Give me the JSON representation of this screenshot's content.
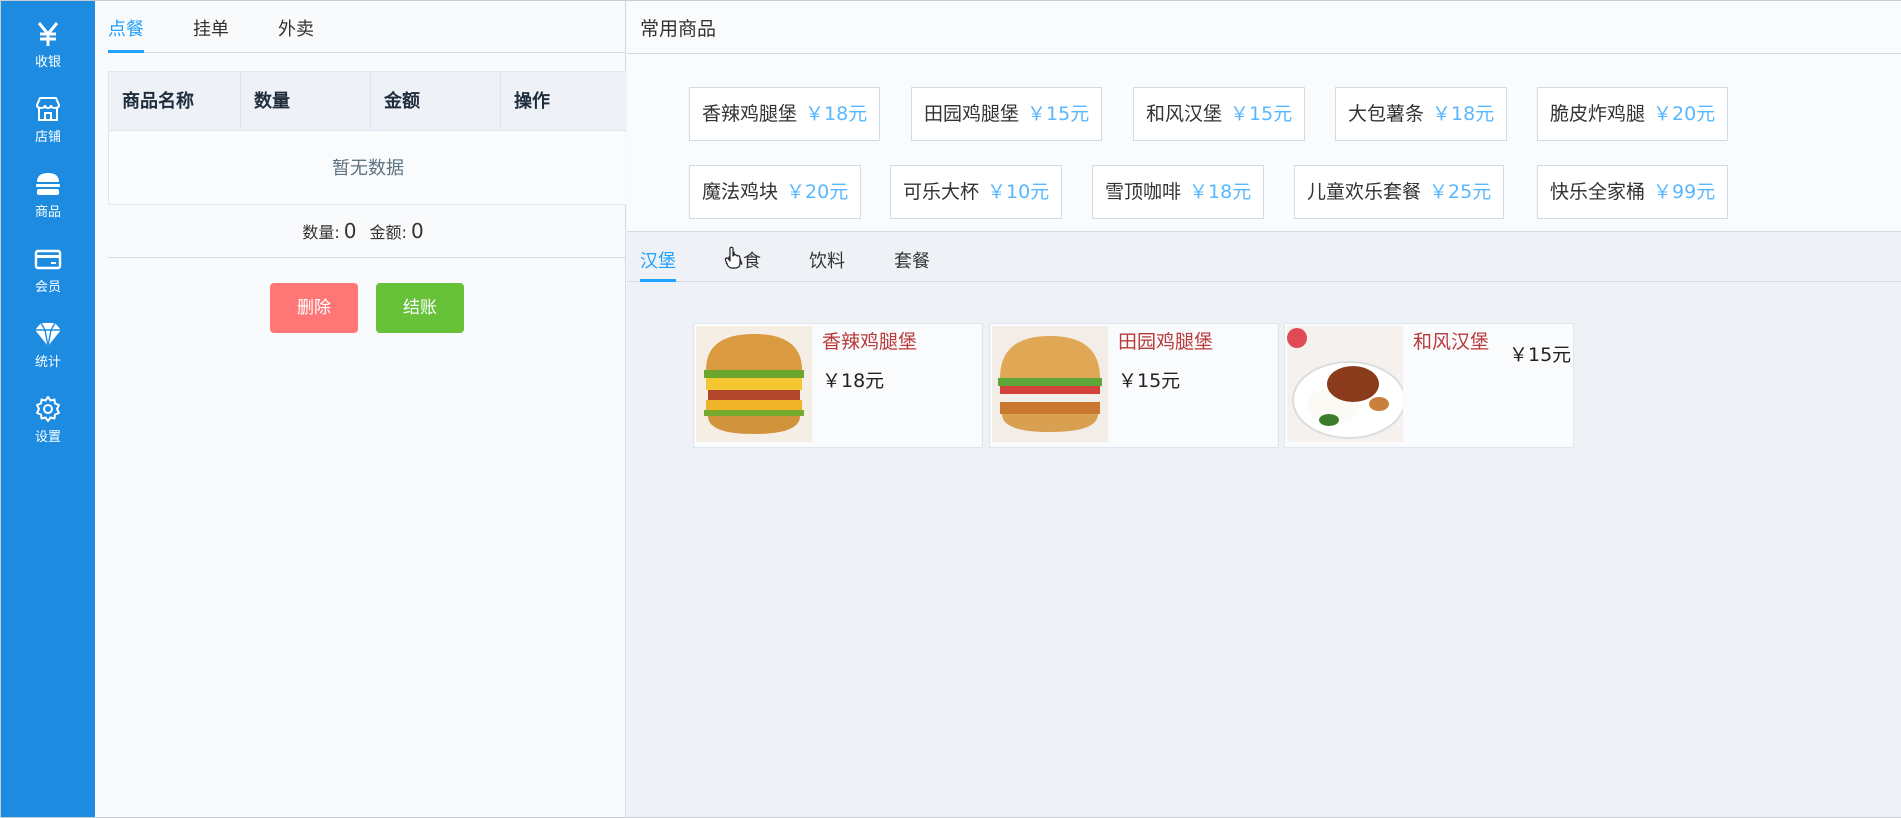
{
  "nav": [
    {
      "label": "收银",
      "icon": "yen-icon"
    },
    {
      "label": "店铺",
      "icon": "store-icon"
    },
    {
      "label": "商品",
      "icon": "burger-icon"
    },
    {
      "label": "会员",
      "icon": "card-icon"
    },
    {
      "label": "统计",
      "icon": "diamond-icon"
    },
    {
      "label": "设置",
      "icon": "gear-icon"
    }
  ],
  "order": {
    "tabs": [
      "点餐",
      "挂单",
      "外卖"
    ],
    "active_tab": "点餐",
    "columns": [
      "商品名称",
      "数量",
      "金额",
      "操作"
    ],
    "empty_text": "暂无数据",
    "count_label": "数量:",
    "count_value": "0",
    "amount_label": "金额:",
    "amount_value": "0",
    "delete_label": "删除",
    "pay_label": "结账"
  },
  "favorites": {
    "title": "常用商品",
    "items": [
      {
        "name": "香辣鸡腿堡",
        "price": "￥18元"
      },
      {
        "name": "田园鸡腿堡",
        "price": "￥15元"
      },
      {
        "name": "和风汉堡",
        "price": "￥15元"
      },
      {
        "name": "大包薯条",
        "price": "￥18元"
      },
      {
        "name": "脆皮炸鸡腿",
        "price": "￥20元"
      },
      {
        "name": "魔法鸡块",
        "price": "￥20元"
      },
      {
        "name": "可乐大杯",
        "price": "￥10元"
      },
      {
        "name": "雪顶咖啡",
        "price": "￥18元"
      },
      {
        "name": "儿童欢乐套餐",
        "price": "￥25元"
      },
      {
        "name": "快乐全家桶",
        "price": "￥99元"
      }
    ]
  },
  "categories": {
    "tabs": [
      "汉堡",
      "小食",
      "饮料",
      "套餐"
    ],
    "active": "汉堡"
  },
  "products": [
    {
      "name": "香辣鸡腿堡",
      "price": "￥18元"
    },
    {
      "name": "田园鸡腿堡",
      "price": "￥15元"
    },
    {
      "name": "和风汉堡",
      "price": "￥15元"
    }
  ],
  "colors": {
    "nav_bg": "#1d8ce0",
    "accent": "#20a0ff",
    "price": "#58b7ff",
    "delete": "#ff7676",
    "pay": "#67c23a"
  }
}
